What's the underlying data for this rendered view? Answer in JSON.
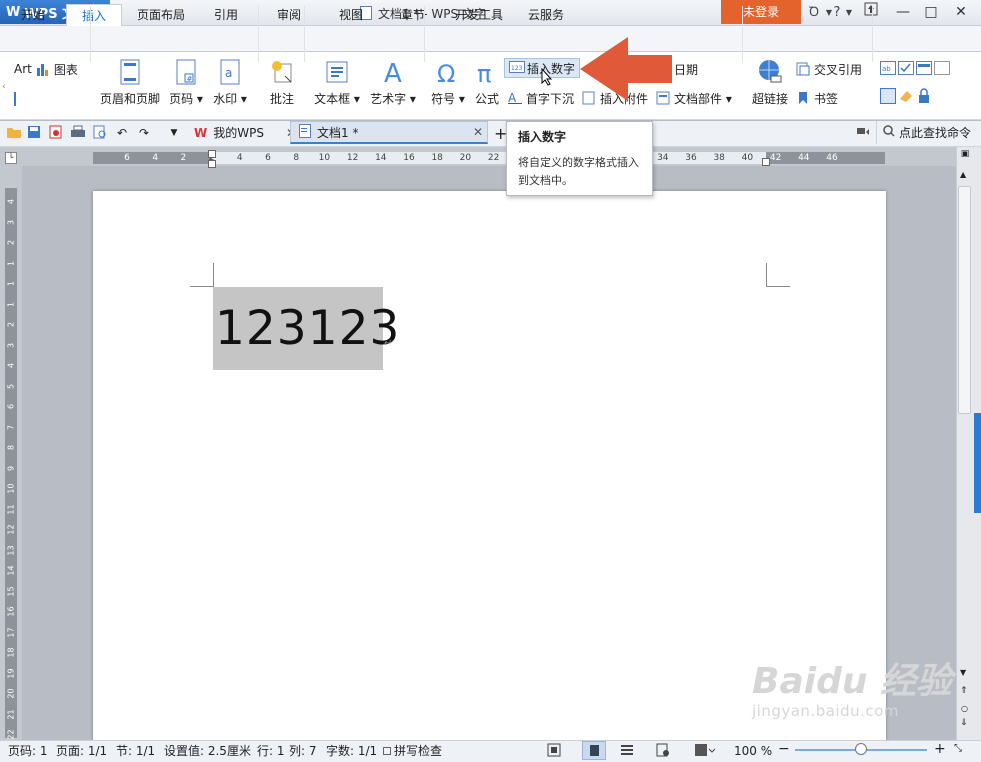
{
  "app": {
    "name": "WPS 文字",
    "window_title": "文档1 * - WPS 文字",
    "login_label": "未登录",
    "help_label": "?"
  },
  "menu": {
    "tabs": [
      "开始",
      "插入",
      "页面布局",
      "引用",
      "审阅",
      "视图",
      "章节",
      "开发工具",
      "云服务"
    ],
    "active": "插入"
  },
  "ribbon": {
    "art_label": "Art",
    "chart_label": "图表",
    "header_footer": "页眉和页脚",
    "page_num": "页码",
    "watermark": "水印",
    "comment": "批注",
    "textbox": "文本框",
    "wordart": "艺术字",
    "symbol": "符号",
    "formula": "公式",
    "insert_number": "插入数字",
    "drop_cap": "首字下沉",
    "attachment": "插入附件",
    "date": "日期",
    "doc_parts": "文档部件",
    "hyperlink": "超链接",
    "cross_ref": "交叉引用",
    "bookmark": "书签"
  },
  "tabs_bar": {
    "tabs": [
      "我的WPS",
      "文档1 *"
    ],
    "add_label": "+",
    "search_label": "点此查找命令"
  },
  "ruler": {
    "horizontal": [
      "6",
      "4",
      "2",
      "2",
      "4",
      "6",
      "8",
      "10",
      "12",
      "14",
      "16",
      "18",
      "20",
      "22",
      "24",
      "26",
      "28",
      "30",
      "32",
      "34",
      "36",
      "38",
      "40",
      "42",
      "44",
      "46"
    ],
    "vertical": [
      "4",
      "3",
      "2",
      "1",
      "1",
      "1",
      "2",
      "3",
      "4",
      "5",
      "6",
      "7",
      "8",
      "9",
      "10",
      "11",
      "12",
      "13",
      "14",
      "15",
      "16",
      "17",
      "18",
      "19",
      "20",
      "21",
      "22"
    ]
  },
  "document": {
    "selected_text": "123123",
    "paragraph_mark": "↵"
  },
  "tooltip": {
    "title": "插入数字",
    "body": "将自定义的数字格式插入到文档中。"
  },
  "status": {
    "page": "页码: 1",
    "pages": "页面: 1/1",
    "section": "节: 1/1",
    "setting": "设置值: 2.5厘米",
    "row": "行: 1",
    "col": "列: 7",
    "words": "字数: 1/1",
    "spellcheck": "拼写检查",
    "zoom": "100 %"
  },
  "watermark": {
    "brand": "Baidu 经验",
    "url": "jingyan.baidu.com"
  },
  "colors": {
    "accent_blue": "#2b7bd3",
    "login_orange": "#e4632d",
    "arrow_red": "#e05a3a"
  }
}
